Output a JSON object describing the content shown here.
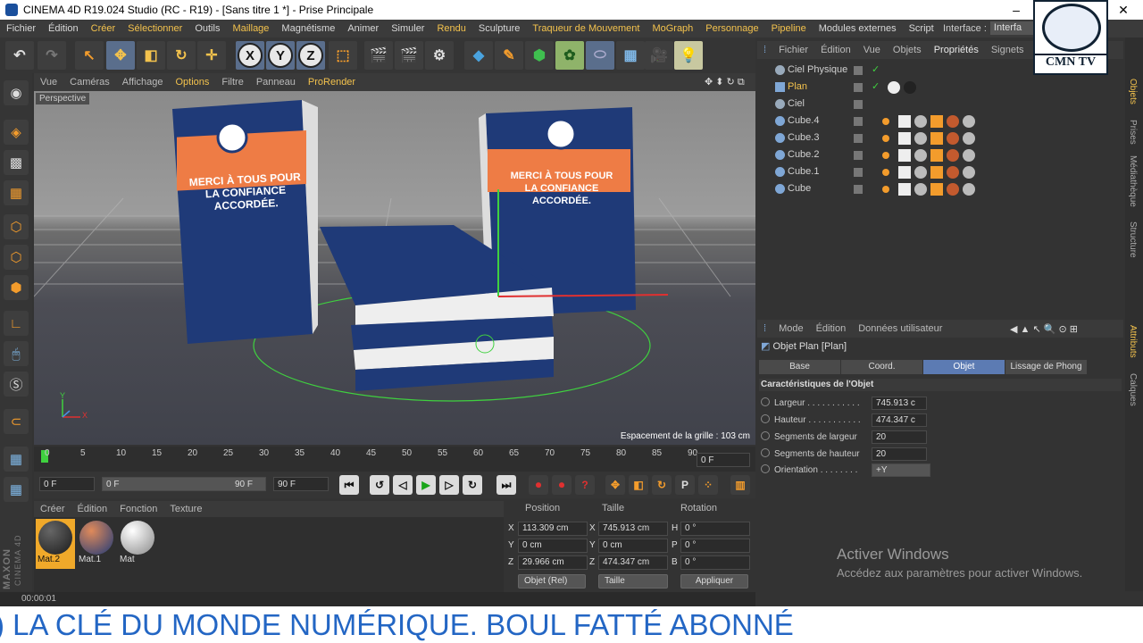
{
  "titlebar": {
    "title": "CINEMA 4D R19.024 Studio (RC - R19) - [Sans titre 1 *] - Prise Principale",
    "minimize": "–",
    "close": "✕"
  },
  "menubar": {
    "items": [
      "Fichier",
      "Édition",
      "Créer",
      "Sélectionner",
      "Outils",
      "Maillage",
      "Magnétisme",
      "Animer",
      "Simuler",
      "Rendu",
      "Sculpture",
      "Traqueur de Mouvement",
      "MoGraph",
      "Personnage",
      "Pipeline",
      "Modules externes",
      "Script"
    ],
    "highlighted": [
      2,
      3,
      5,
      9,
      11,
      12,
      13,
      14
    ],
    "interface_label": "Interface :",
    "interface_value": "Interfa"
  },
  "toolbar": {
    "x": "X",
    "y": "Y",
    "z": "Z"
  },
  "viewport": {
    "menu": [
      "Vue",
      "Caméras",
      "Affichage",
      "Options",
      "Filtre",
      "Panneau",
      "ProRender"
    ],
    "highlighted": [
      3,
      6
    ],
    "label": "Perspective",
    "grid_spacing": "Espacement de la grille : 103 cm",
    "book_title_1": "MERCI À TOUS POUR",
    "book_title_2": "LA CONFIANCE ACCORDÉE.",
    "axis_x": "X",
    "axis_y": "Y"
  },
  "timeline": {
    "ticks": [
      "0",
      "5",
      "10",
      "15",
      "20",
      "25",
      "30",
      "35",
      "40",
      "45",
      "50",
      "55",
      "60",
      "65",
      "70",
      "75",
      "80",
      "85",
      "90"
    ],
    "current_frame": "0 F",
    "start": "0 F",
    "range_start": "0 F",
    "range_end": "90 F",
    "end": "90 F"
  },
  "materials": {
    "menu": [
      "Créer",
      "Édition",
      "Fonction",
      "Texture"
    ],
    "items": [
      {
        "name": "Mat.2",
        "selected": true,
        "color": "#2a2a2a"
      },
      {
        "name": "Mat.1",
        "selected": false,
        "color": "#c35a2e"
      },
      {
        "name": "Mat",
        "selected": false,
        "color": "#d8d8d8"
      }
    ]
  },
  "coords": {
    "headers": [
      "Position",
      "Taille",
      "Rotation"
    ],
    "rows": [
      {
        "a": "X",
        "pos": "113.309 cm",
        "b": "X",
        "size": "745.913 cm",
        "c": "H",
        "rot": "0 °"
      },
      {
        "a": "Y",
        "pos": "0 cm",
        "b": "Y",
        "size": "0 cm",
        "c": "P",
        "rot": "0 °"
      },
      {
        "a": "Z",
        "pos": "29.966 cm",
        "b": "Z",
        "size": "474.347 cm",
        "c": "B",
        "rot": "0 °"
      }
    ],
    "mode": "Objet (Rel)",
    "size_mode": "Taille",
    "apply": "Appliquer"
  },
  "status": {
    "time": "00:00:01"
  },
  "maxon": {
    "brand": "MAXON",
    "product": "CINEMA 4D"
  },
  "objects": {
    "menu": [
      "Fichier",
      "Édition",
      "Vue",
      "Objets",
      "Propriétés",
      "Signets"
    ],
    "highlighted": [
      4
    ],
    "items": [
      {
        "name": "Ciel Physique",
        "selected": false,
        "icon_color": "#7fa7d6"
      },
      {
        "name": "Plan",
        "selected": true,
        "icon_color": "#7fa7d6"
      },
      {
        "name": "Ciel",
        "selected": false,
        "icon_color": "#7fa7d6"
      },
      {
        "name": "Cube.4",
        "selected": false,
        "icon_color": "#7fa7d6"
      },
      {
        "name": "Cube.3",
        "selected": false,
        "icon_color": "#7fa7d6"
      },
      {
        "name": "Cube.2",
        "selected": false,
        "icon_color": "#7fa7d6"
      },
      {
        "name": "Cube.1",
        "selected": false,
        "icon_color": "#7fa7d6"
      },
      {
        "name": "Cube",
        "selected": false,
        "icon_color": "#7fa7d6"
      }
    ]
  },
  "attributes": {
    "menu": [
      "Mode",
      "Édition",
      "Données utilisateur"
    ],
    "title": "Objet Plan [Plan]",
    "tabs": [
      "Base",
      "Coord.",
      "Objet",
      "Lissage de Phong"
    ],
    "selected_tab": 2,
    "section": "Caractéristiques de l'Objet",
    "fields": [
      {
        "label": "Largeur . . . . . . . . . . .",
        "value": "745.913 c"
      },
      {
        "label": "Hauteur . . . . . . . . . . .",
        "value": "474.347 c"
      },
      {
        "label": "Segments de largeur",
        "value": "20"
      },
      {
        "label": "Segments de hauteur",
        "value": "20"
      },
      {
        "label": "Orientation . . . . . . . .",
        "value": "+Y"
      }
    ]
  },
  "watermark": {
    "line1": "Activer Windows",
    "line2": "Accédez aux paramètres pour activer Windows."
  },
  "side_tabs": [
    "Objets",
    "Prises",
    "Médiathèque",
    "Structure",
    "Attributs",
    "Calques"
  ],
  "logo": {
    "name": "CMN TV"
  },
  "marquee": {
    "text": ") LA CLÉ DU MONDE NUMÉRIQUE. BOUL FATTÉ ABONNÉ"
  },
  "colors": {
    "accent": "#f3c24d",
    "selection_blue": "#5c7bb3",
    "marquee": "#2366c4"
  }
}
